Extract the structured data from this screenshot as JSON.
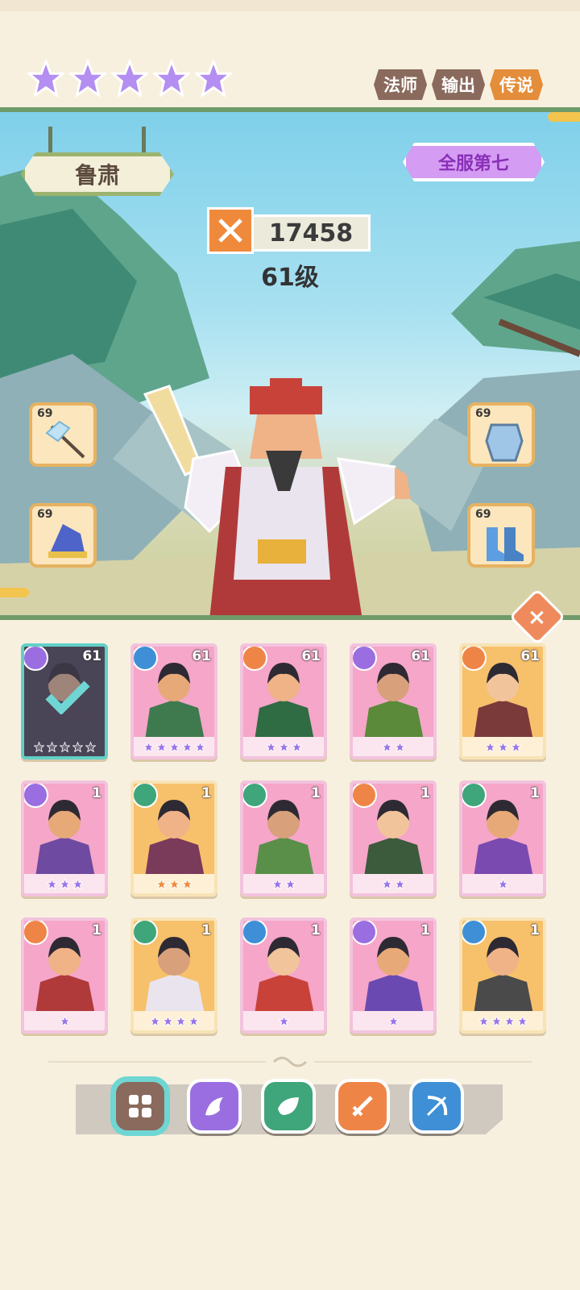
{
  "header": {
    "star_count": 5,
    "star_color": "#b48ef0",
    "tags": [
      {
        "label": "法师",
        "color": "#8a6a5c"
      },
      {
        "label": "输出",
        "color": "#8a6a5c"
      },
      {
        "label": "传说",
        "color": "#e48d3a"
      }
    ]
  },
  "hero": {
    "name": "鲁肃",
    "server_rank": "全服第七",
    "power": "17458",
    "level": "61级"
  },
  "equipment": [
    {
      "slot": "weapon",
      "level": "69",
      "icon": "halberd-icon"
    },
    {
      "slot": "armor",
      "level": "69",
      "icon": "armor-icon"
    },
    {
      "slot": "helmet",
      "level": "69",
      "icon": "hat-icon"
    },
    {
      "slot": "boots",
      "level": "69",
      "icon": "boots-icon"
    }
  ],
  "roster": [
    {
      "level": "61",
      "stars": 5,
      "faction": "mage",
      "frame": "selected",
      "selected": true
    },
    {
      "level": "61",
      "stars": 5,
      "faction": "archer",
      "frame": "purple"
    },
    {
      "level": "61",
      "stars": 3,
      "faction": "warrior",
      "frame": "purple"
    },
    {
      "level": "61",
      "stars": 2,
      "faction": "mage",
      "frame": "purple"
    },
    {
      "level": "61",
      "stars": 3,
      "faction": "warrior",
      "frame": "gold"
    },
    {
      "level": "1",
      "stars": 3,
      "faction": "mage",
      "frame": "purple"
    },
    {
      "level": "1",
      "stars": 3,
      "faction": "support",
      "frame": "gold",
      "star_color": "#ef8a3c"
    },
    {
      "level": "1",
      "stars": 2,
      "faction": "support",
      "frame": "purple"
    },
    {
      "level": "1",
      "stars": 2,
      "faction": "warrior",
      "frame": "purple"
    },
    {
      "level": "1",
      "stars": 1,
      "faction": "support",
      "frame": "purple"
    },
    {
      "level": "1",
      "stars": 1,
      "faction": "warrior",
      "frame": "purple"
    },
    {
      "level": "1",
      "stars": 4,
      "faction": "support",
      "frame": "gold"
    },
    {
      "level": "1",
      "stars": 1,
      "faction": "archer",
      "frame": "purple"
    },
    {
      "level": "1",
      "stars": 1,
      "faction": "mage",
      "frame": "purple"
    },
    {
      "level": "1",
      "stars": 4,
      "faction": "archer",
      "frame": "gold"
    }
  ],
  "faction_colors": {
    "mage": "#9a6ee0",
    "archer": "#3e8fd6",
    "warrior": "#ee8546",
    "support": "#3fa57a"
  },
  "filters": [
    {
      "name": "all",
      "icon": "grid-icon",
      "active": true
    },
    {
      "name": "mage",
      "icon": "mage-icon"
    },
    {
      "name": "support",
      "icon": "leaf-icon"
    },
    {
      "name": "warrior",
      "icon": "sword-icon"
    },
    {
      "name": "archer",
      "icon": "bow-icon"
    }
  ]
}
